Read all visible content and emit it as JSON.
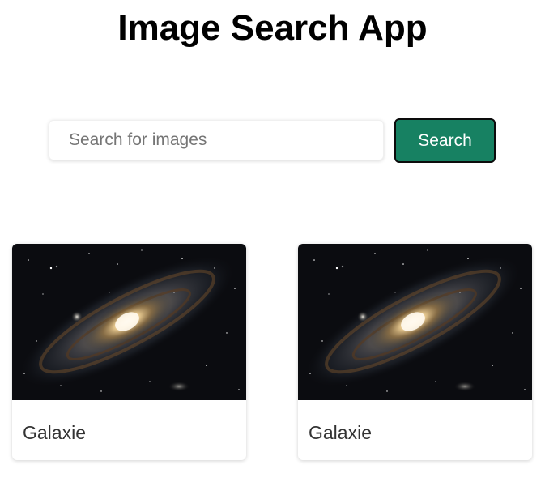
{
  "app": {
    "title": "Image Search App"
  },
  "search": {
    "placeholder": "Search for images",
    "value": "",
    "button_label": "Search"
  },
  "results": [
    {
      "caption": "Galaxie",
      "image": "galaxy-photo"
    },
    {
      "caption": "Galaxie",
      "image": "galaxy-photo"
    }
  ],
  "colors": {
    "button_bg": "#178162",
    "button_text": "#ffffff",
    "caption_text": "#333333",
    "space_bg": "#0b0c10"
  }
}
